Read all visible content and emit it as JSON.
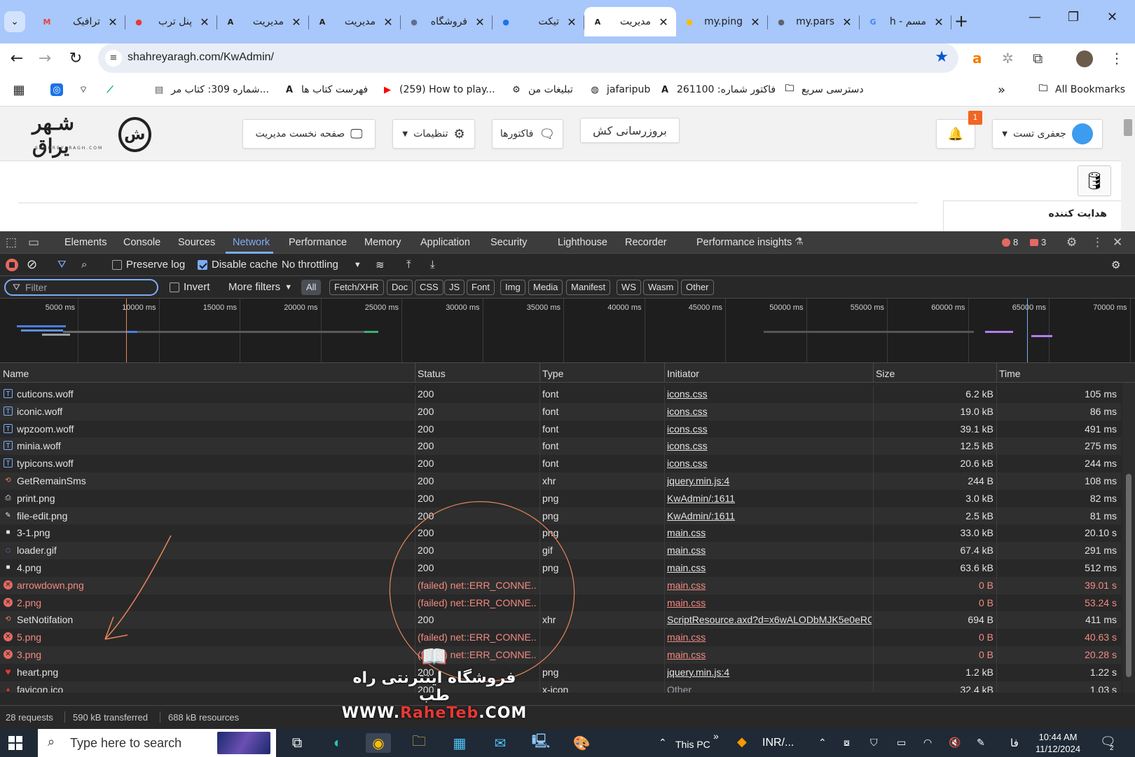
{
  "browser": {
    "tabs": [
      {
        "title": "ترافیک",
        "icon": "gmail-icon",
        "icon_color": "#ea4335"
      },
      {
        "title": "پنل ترب",
        "icon": "torob-icon",
        "icon_color": "#e53935"
      },
      {
        "title": "مدیریت",
        "icon": "admin-a-icon",
        "icon_color": "#1f1f1f"
      },
      {
        "title": "مدیریت",
        "icon": "admin-a-icon",
        "icon_color": "#1f1f1f"
      },
      {
        "title": "فروشگاه",
        "icon": "store-icon",
        "icon_color": "#5f6f8f"
      },
      {
        "title": "تیکت",
        "icon": "ticket-icon",
        "icon_color": "#1a73e8"
      },
      {
        "title": "مدیریت",
        "icon": "admin-a-icon",
        "icon_color": "#1f1f1f",
        "active": true
      },
      {
        "title": "my.ping",
        "icon": "ping-icon",
        "icon_color": "#fbbc04"
      },
      {
        "title": "my.pars",
        "icon": "globe-icon",
        "icon_color": "#5f6368"
      },
      {
        "title": "h - مسم",
        "icon": "google-icon",
        "icon_color": "#4285f4"
      }
    ],
    "url": "shahreyaragh.com/KwAdmin/",
    "bookmarks": [
      {
        "label": "شماره 309: کتاب مر...",
        "icon": "doc-icon"
      },
      {
        "label": "فهرست کتاب ها",
        "icon": "admin-a-icon"
      },
      {
        "label": "(259) How to play...",
        "icon": "youtube-icon"
      },
      {
        "label": "تبلیغات من",
        "icon": "gear-badge-icon"
      },
      {
        "label": "jafaripub",
        "icon": "globe-icon"
      },
      {
        "label": "فاکتور شماره: 261100",
        "icon": "admin-a-icon"
      },
      {
        "label": "دسترسی سریع",
        "icon": "folder-icon"
      }
    ],
    "all_bookmarks": "All Bookmarks"
  },
  "site": {
    "logo_text": "شـهر یراق",
    "logo_sub": "SHAHREYARAGH.COM",
    "buttons": {
      "home": "صفحه نخست مدیریت",
      "settings": "تنظیمات",
      "invoices": "فاکتورها",
      "refresh_cache": "بروزرسانی کش",
      "user": "جعفری تست"
    },
    "notification_count": "1",
    "side_label": "هدایت کننده"
  },
  "devtools": {
    "tabs": [
      "Elements",
      "Console",
      "Sources",
      "Network",
      "Performance",
      "Memory",
      "Application",
      "Security",
      "Lighthouse",
      "Recorder",
      "Performance insights"
    ],
    "active_tab": "Network",
    "error_count": "8",
    "warning_count": "3",
    "toolbar": {
      "preserve_log": "Preserve log",
      "disable_cache": "Disable cache",
      "throttling": "No throttling"
    },
    "filter": {
      "placeholder": "Filter",
      "invert": "Invert",
      "more_filters": "More filters",
      "chips": [
        "All",
        "Fetch/XHR",
        "Doc",
        "CSS",
        "JS",
        "Font",
        "Img",
        "Media",
        "Manifest",
        "WS",
        "Wasm",
        "Other"
      ],
      "active_chip": "All"
    },
    "timeline_ticks": [
      "5000 ms",
      "10000 ms",
      "15000 ms",
      "20000 ms",
      "25000 ms",
      "30000 ms",
      "35000 ms",
      "40000 ms",
      "45000 ms",
      "50000 ms",
      "55000 ms",
      "60000 ms",
      "65000 ms",
      "70000 ms"
    ],
    "columns": [
      "Name",
      "Status",
      "Type",
      "Initiator",
      "Size",
      "Time"
    ],
    "rows": [
      {
        "name": "cuticons.woff",
        "status": "200",
        "type": "font",
        "initiator": "icons.css",
        "size": "6.2 kB",
        "time": "105 ms",
        "icon": "font-file-icon",
        "failed": false
      },
      {
        "name": "iconic.woff",
        "status": "200",
        "type": "font",
        "initiator": "icons.css",
        "size": "19.0 kB",
        "time": "86 ms",
        "icon": "font-file-icon",
        "failed": false
      },
      {
        "name": "wpzoom.woff",
        "status": "200",
        "type": "font",
        "initiator": "icons.css",
        "size": "39.1 kB",
        "time": "491 ms",
        "icon": "font-file-icon",
        "failed": false
      },
      {
        "name": "minia.woff",
        "status": "200",
        "type": "font",
        "initiator": "icons.css",
        "size": "12.5 kB",
        "time": "275 ms",
        "icon": "font-file-icon",
        "failed": false
      },
      {
        "name": "typicons.woff",
        "status": "200",
        "type": "font",
        "initiator": "icons.css",
        "size": "20.6 kB",
        "time": "244 ms",
        "icon": "font-file-icon",
        "failed": false
      },
      {
        "name": "GetRemainSms",
        "status": "200",
        "type": "xhr",
        "initiator": "jquery.min.js:4",
        "size": "244 B",
        "time": "108 ms",
        "icon": "xhr-icon",
        "failed": false
      },
      {
        "name": "print.png",
        "status": "200",
        "type": "png",
        "initiator": "KwAdmin/:1611",
        "size": "3.0 kB",
        "time": "82 ms",
        "icon": "printer-icon",
        "failed": false
      },
      {
        "name": "file-edit.png",
        "status": "200",
        "type": "png",
        "initiator": "KwAdmin/:1611",
        "size": "2.5 kB",
        "time": "81 ms",
        "icon": "file-edit-icon",
        "failed": false
      },
      {
        "name": "3-1.png",
        "status": "200",
        "type": "png",
        "initiator": "main.css",
        "size": "33.0 kB",
        "time": "20.10 s",
        "icon": "image-icon",
        "failed": false
      },
      {
        "name": "loader.gif",
        "status": "200",
        "type": "gif",
        "initiator": "main.css",
        "size": "67.4 kB",
        "time": "291 ms",
        "icon": "loader-icon",
        "failed": false
      },
      {
        "name": "4.png",
        "status": "200",
        "type": "png",
        "initiator": "main.css",
        "size": "63.6 kB",
        "time": "512 ms",
        "icon": "image-icon",
        "failed": false
      },
      {
        "name": "arrowdown.png",
        "status": "(failed) net::ERR_CONNE...",
        "type": "",
        "initiator": "main.css",
        "size": "0 B",
        "time": "39.01 s",
        "icon": "error-icon",
        "failed": true
      },
      {
        "name": "2.png",
        "status": "(failed) net::ERR_CONNE...",
        "type": "",
        "initiator": "main.css",
        "size": "0 B",
        "time": "53.24 s",
        "icon": "error-icon",
        "failed": true
      },
      {
        "name": "SetNotifation",
        "status": "200",
        "type": "xhr",
        "initiator": "ScriptResource.axd?d=x6wALODbMJK5e0eRC_",
        "size": "694 B",
        "time": "411 ms",
        "icon": "xhr-icon",
        "failed": false
      },
      {
        "name": "5.png",
        "status": "(failed) net::ERR_CONNE...",
        "type": "",
        "initiator": "main.css",
        "size": "0 B",
        "time": "40.63 s",
        "icon": "error-icon",
        "failed": true
      },
      {
        "name": "3.png",
        "status": "(failed) net::ERR_CONNE...",
        "type": "",
        "initiator": "main.css",
        "size": "0 B",
        "time": "20.28 s",
        "icon": "error-icon",
        "failed": true
      },
      {
        "name": "heart.png",
        "status": "200",
        "type": "png",
        "initiator": "jquery.min.js:4",
        "size": "1.2 kB",
        "time": "1.22 s",
        "icon": "heart-icon",
        "failed": false
      },
      {
        "name": "favicon.ico",
        "status": "200",
        "type": "x-icon",
        "initiator": "Other",
        "size": "32.4 kB",
        "time": "1.03 s",
        "icon": "favicon-icon",
        "failed": false
      }
    ],
    "summary": {
      "requests": "28 requests",
      "transferred": "590 kB transferred",
      "resources": "688 kB resources"
    }
  },
  "watermark": {
    "fa": "فروشگاه اینترنتی راه طب",
    "en_prefix": "WWW.",
    "en_brand": "RaheTeb",
    "en_suffix": ".COM"
  },
  "taskbar": {
    "search_placeholder": "Type here to search",
    "this_pc": "This PC",
    "currency": "INR/...",
    "lang": "فا",
    "time": "10:44 AM",
    "date": "11/12/2024",
    "notifications": "2"
  },
  "colors": {
    "accent": "#7cacf8",
    "error": "#f28b82",
    "tabstrip": "#a8c7fa",
    "devtools_bg": "#282828"
  }
}
